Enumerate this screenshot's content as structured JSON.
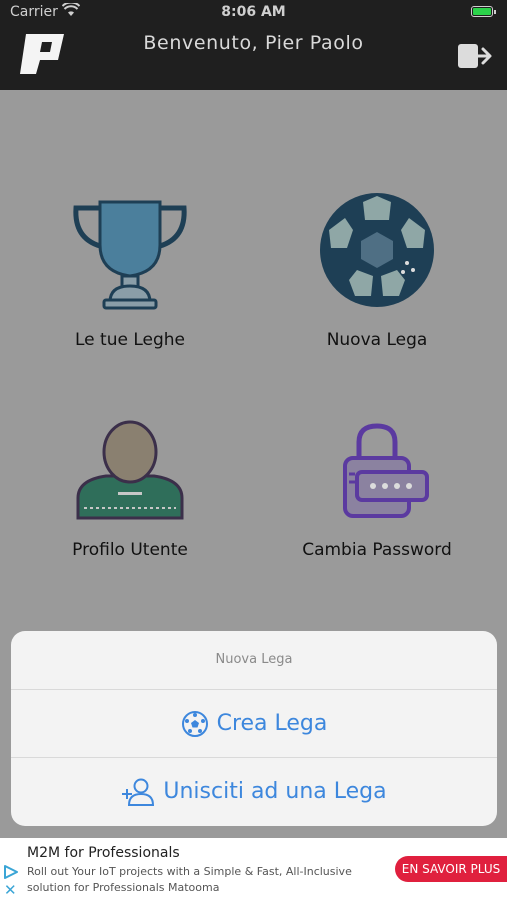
{
  "status_bar": {
    "carrier": "Carrier",
    "time": "8:06 AM"
  },
  "nav": {
    "title": "Benvenuto, Pier Paolo"
  },
  "menu": {
    "leagues_label": "Le tue Leghe",
    "new_league_label": "Nuova Lega",
    "profile_label": "Profilo Utente",
    "password_label": "Cambia Password"
  },
  "action_sheet": {
    "title": "Nuova Lega",
    "create_label": "Crea Lega",
    "join_label": "Unisciti ad una Lega"
  },
  "ad": {
    "title": "M2M for Professionals",
    "body": "Roll out Your IoT projects with a Simple & Fast, All-Inclusive solution for Professionals Matooma",
    "cta": "EN SAVOIR PLUS"
  },
  "colors": {
    "accent": "#3d87dd",
    "ad_cta": "#e0203e",
    "bar": "#1f1f1f"
  }
}
